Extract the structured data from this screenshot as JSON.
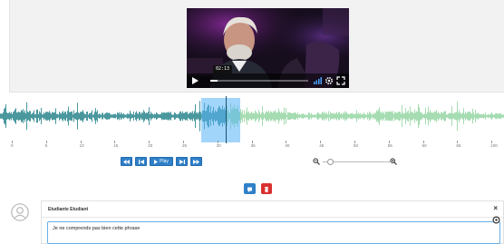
{
  "video": {
    "time_tooltip": "02:13",
    "progress": 0.07
  },
  "timeline": {
    "ticks": [
      "0",
      "5",
      "10",
      "15",
      "20",
      "25",
      "30",
      "35",
      "40",
      "45",
      "50",
      "55",
      "60",
      "65",
      "100"
    ]
  },
  "playback": {
    "rewind_icon": "fast-backward-icon",
    "prev_icon": "step-backward-icon",
    "play_label": "Play",
    "next_icon": "step-forward-icon",
    "forward_icon": "fast-forward-icon"
  },
  "zoom": {
    "out_icon": "zoom-out-icon",
    "in_icon": "zoom-in-icon",
    "level": 0.12
  },
  "actions": {
    "comment_icon": "comment-icon",
    "delete_icon": "trash-icon"
  },
  "comment": {
    "author": "Etudiante Etudiant",
    "text": "Je ne comprends pas bien cette phrase",
    "close_label": "×"
  },
  "colors": {
    "accent": "#2f80c8",
    "danger": "#d9302f",
    "wave_played": "#1e7f86",
    "wave_unplayed": "#8fd49e",
    "region": "#56b2f5"
  }
}
